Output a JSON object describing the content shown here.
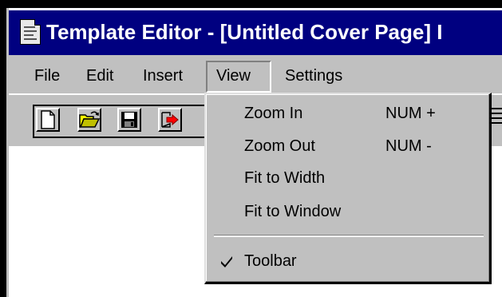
{
  "window": {
    "title": "Template Editor - [Untitled Cover Page] I",
    "icon": "document-template-icon"
  },
  "menubar": {
    "items": [
      {
        "label": "File"
      },
      {
        "label": "Edit"
      },
      {
        "label": "Insert"
      },
      {
        "label": "View",
        "open": true
      },
      {
        "label": "Settings"
      }
    ]
  },
  "toolbar": {
    "buttons": [
      {
        "icon": "new-document-icon"
      },
      {
        "icon": "open-folder-icon"
      },
      {
        "icon": "save-disk-icon"
      },
      {
        "icon": "exit-arrow-icon"
      }
    ]
  },
  "view_menu": {
    "items": [
      {
        "label": "Zoom In",
        "shortcut": "NUM +"
      },
      {
        "label": "Zoom Out",
        "shortcut": "NUM -"
      },
      {
        "label": "Fit to Width",
        "shortcut": ""
      },
      {
        "label": "Fit to Window",
        "shortcut": ""
      },
      {
        "label": "Toolbar",
        "shortcut": "",
        "checked": true
      }
    ]
  },
  "colors": {
    "titlebar": "#000080",
    "face": "#c0c0c0",
    "workspace": "#ffffff"
  }
}
